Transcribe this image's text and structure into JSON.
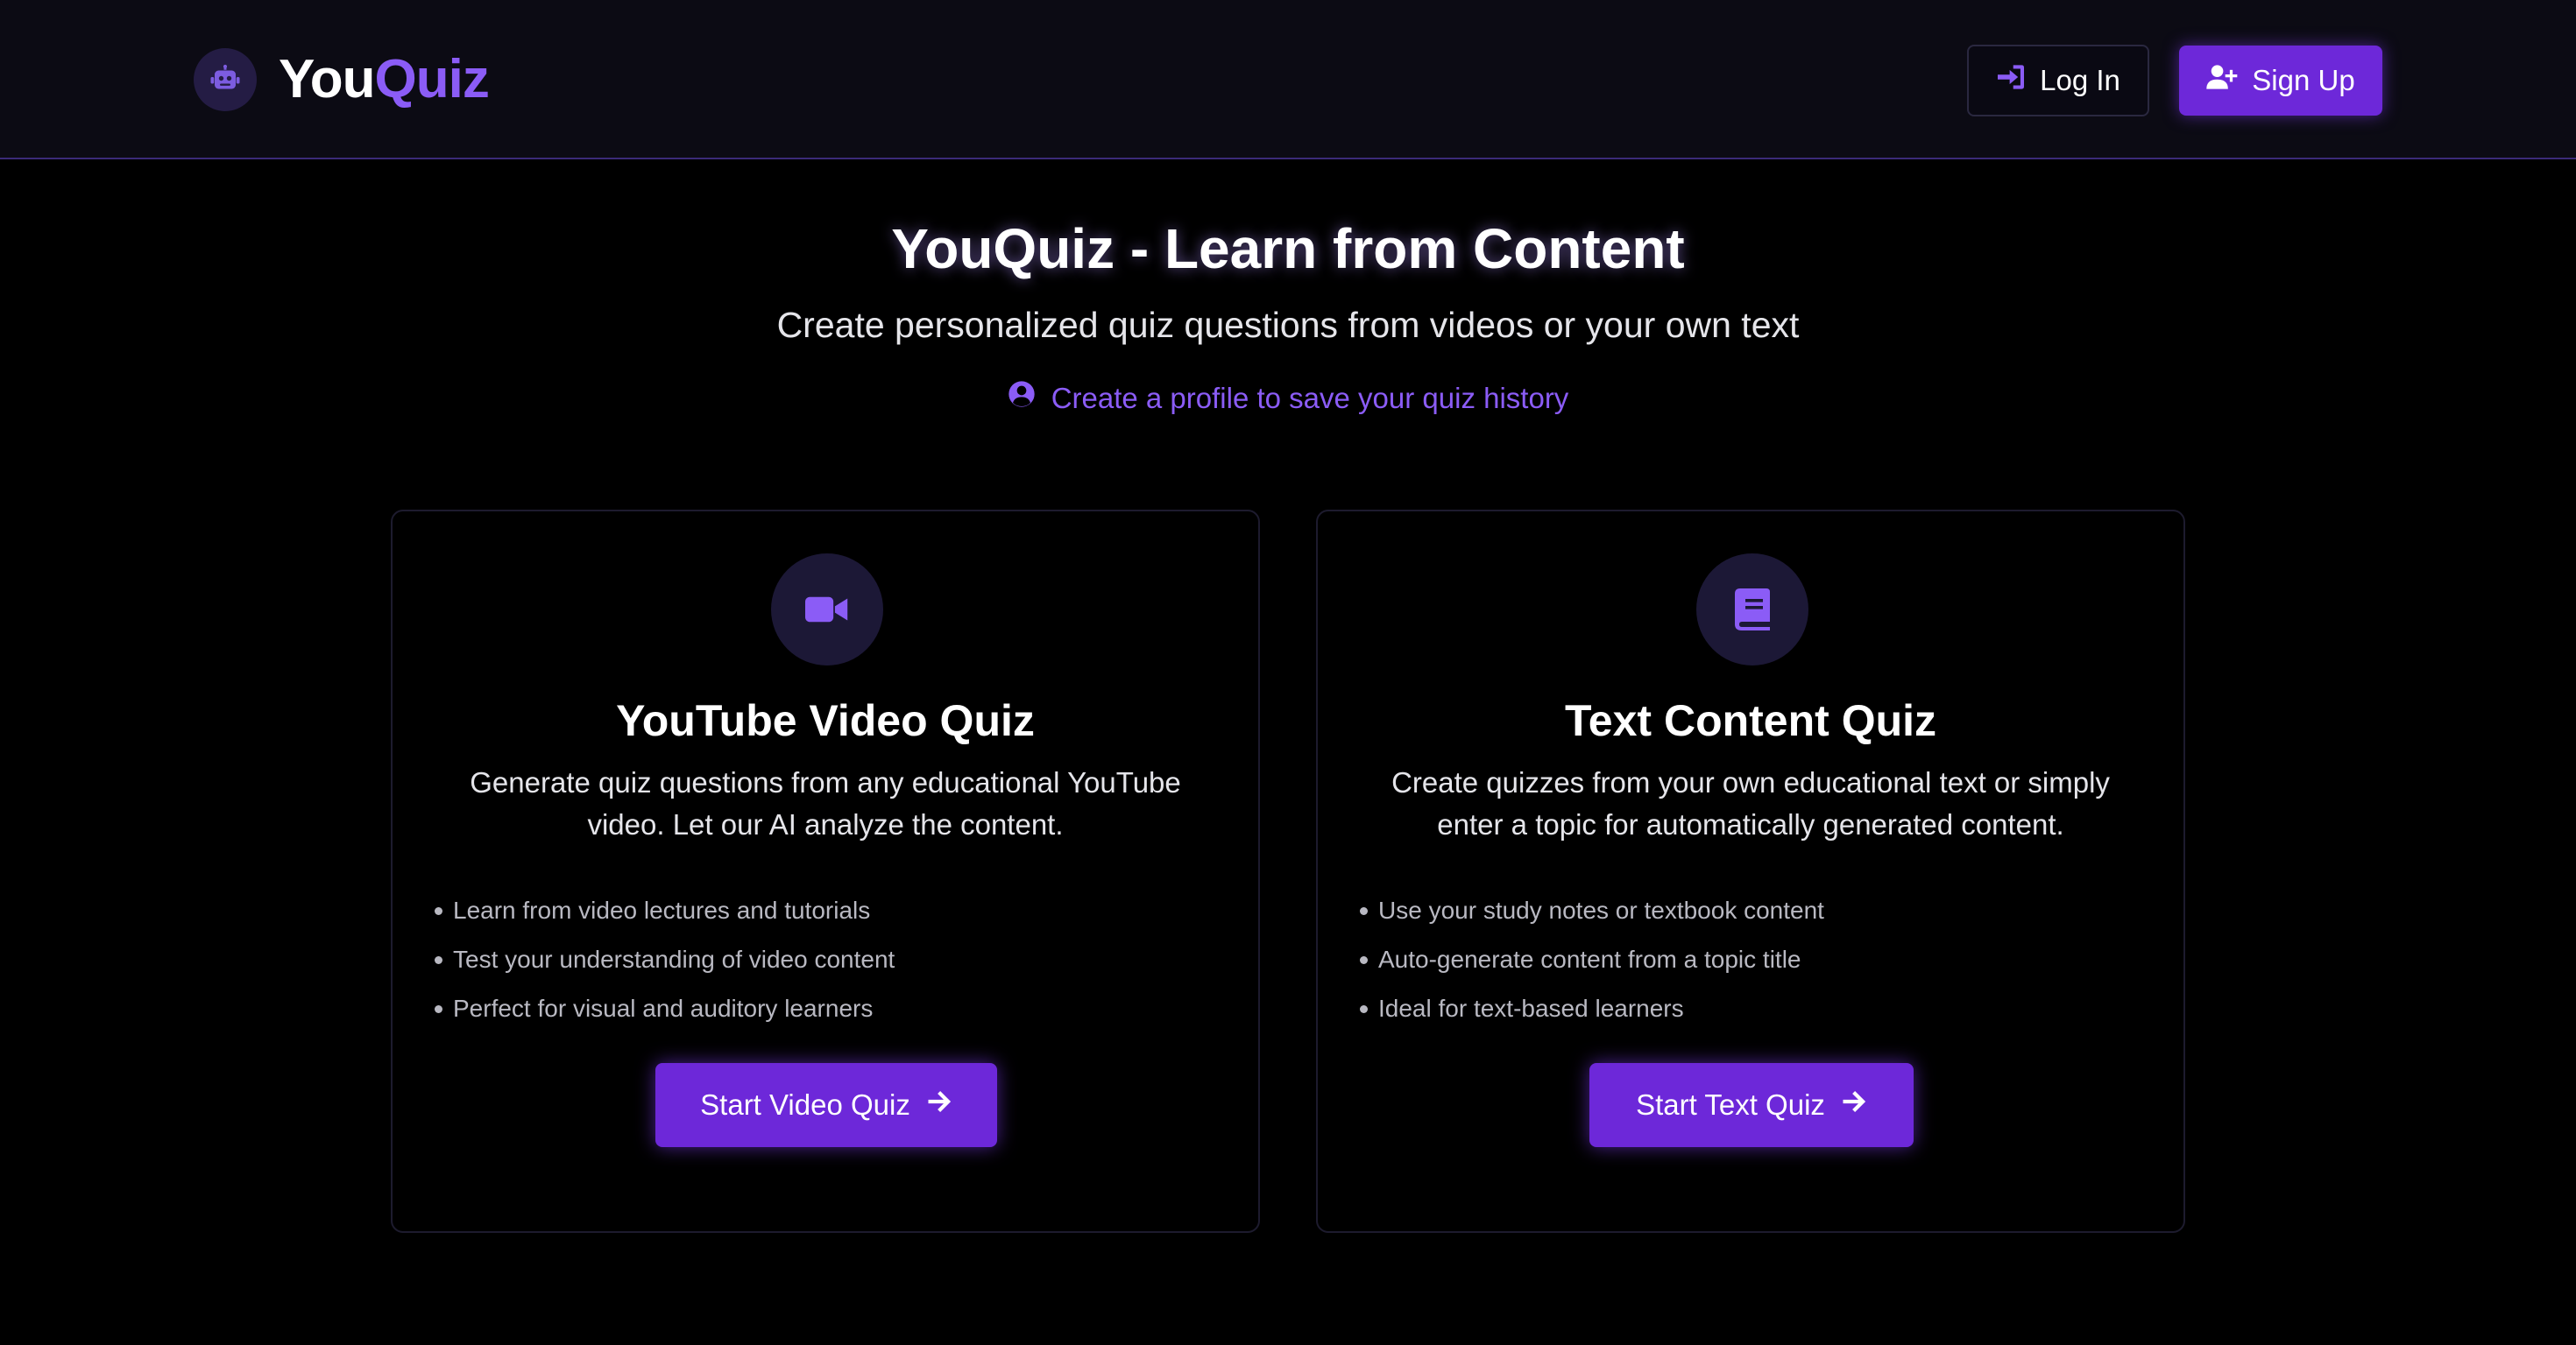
{
  "header": {
    "logo_you": "You",
    "logo_quiz": "Quiz",
    "logo_icon": "robot-icon",
    "login_label": "Log In",
    "login_icon": "sign-in-icon",
    "signup_label": "Sign Up",
    "signup_icon": "user-plus-icon"
  },
  "hero": {
    "title": "YouQuiz - Learn from Content",
    "subtitle": "Create personalized quiz questions from videos or your own text",
    "profile_link": "Create a profile to save your quiz history",
    "profile_icon": "user-circle-icon"
  },
  "cards": [
    {
      "icon": "video-camera-icon",
      "title": "YouTube Video Quiz",
      "description": "Generate quiz questions from any educational YouTube video. Let our AI analyze the content.",
      "features": [
        "Learn from video lectures and tutorials",
        "Test your understanding of video content",
        "Perfect for visual and auditory learners"
      ],
      "button_label": "Start Video Quiz",
      "button_icon": "arrow-right-icon"
    },
    {
      "icon": "book-icon",
      "title": "Text Content Quiz",
      "description": "Create quizzes from your own educational text or simply enter a topic for automatically generated content.",
      "features": [
        "Use your study notes or textbook content",
        "Auto-generate content from a topic title",
        "Ideal for text-based learners"
      ],
      "button_label": "Start Text Quiz",
      "button_icon": "arrow-right-icon"
    }
  ],
  "colors": {
    "accent": "#8b5cf6",
    "button": "#6d28d9",
    "background": "#000000",
    "header_bg": "#0c0b14"
  }
}
